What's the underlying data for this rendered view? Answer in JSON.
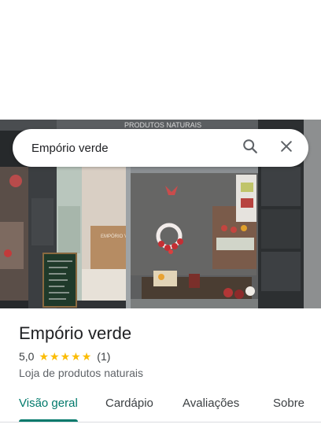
{
  "search": {
    "query": "Empório verde"
  },
  "icons": {
    "search": "search-icon",
    "close": "close-icon",
    "star": "star-icon"
  },
  "storefront": {
    "sign_text": "PRODUTOS NATURAIS",
    "wall_text": "EMPÓRIO V"
  },
  "place": {
    "name": "Empório verde",
    "rating": "5,0",
    "stars": 5,
    "review_count": "(1)",
    "category": "Loja de produtos naturais"
  },
  "tabs": [
    {
      "label": "Visão geral",
      "active": true
    },
    {
      "label": "Cardápio",
      "active": false
    },
    {
      "label": "Avaliações",
      "active": false
    },
    {
      "label": "Sobre",
      "active": false
    }
  ],
  "colors": {
    "accent": "#00796b",
    "star": "#fbbc04"
  }
}
